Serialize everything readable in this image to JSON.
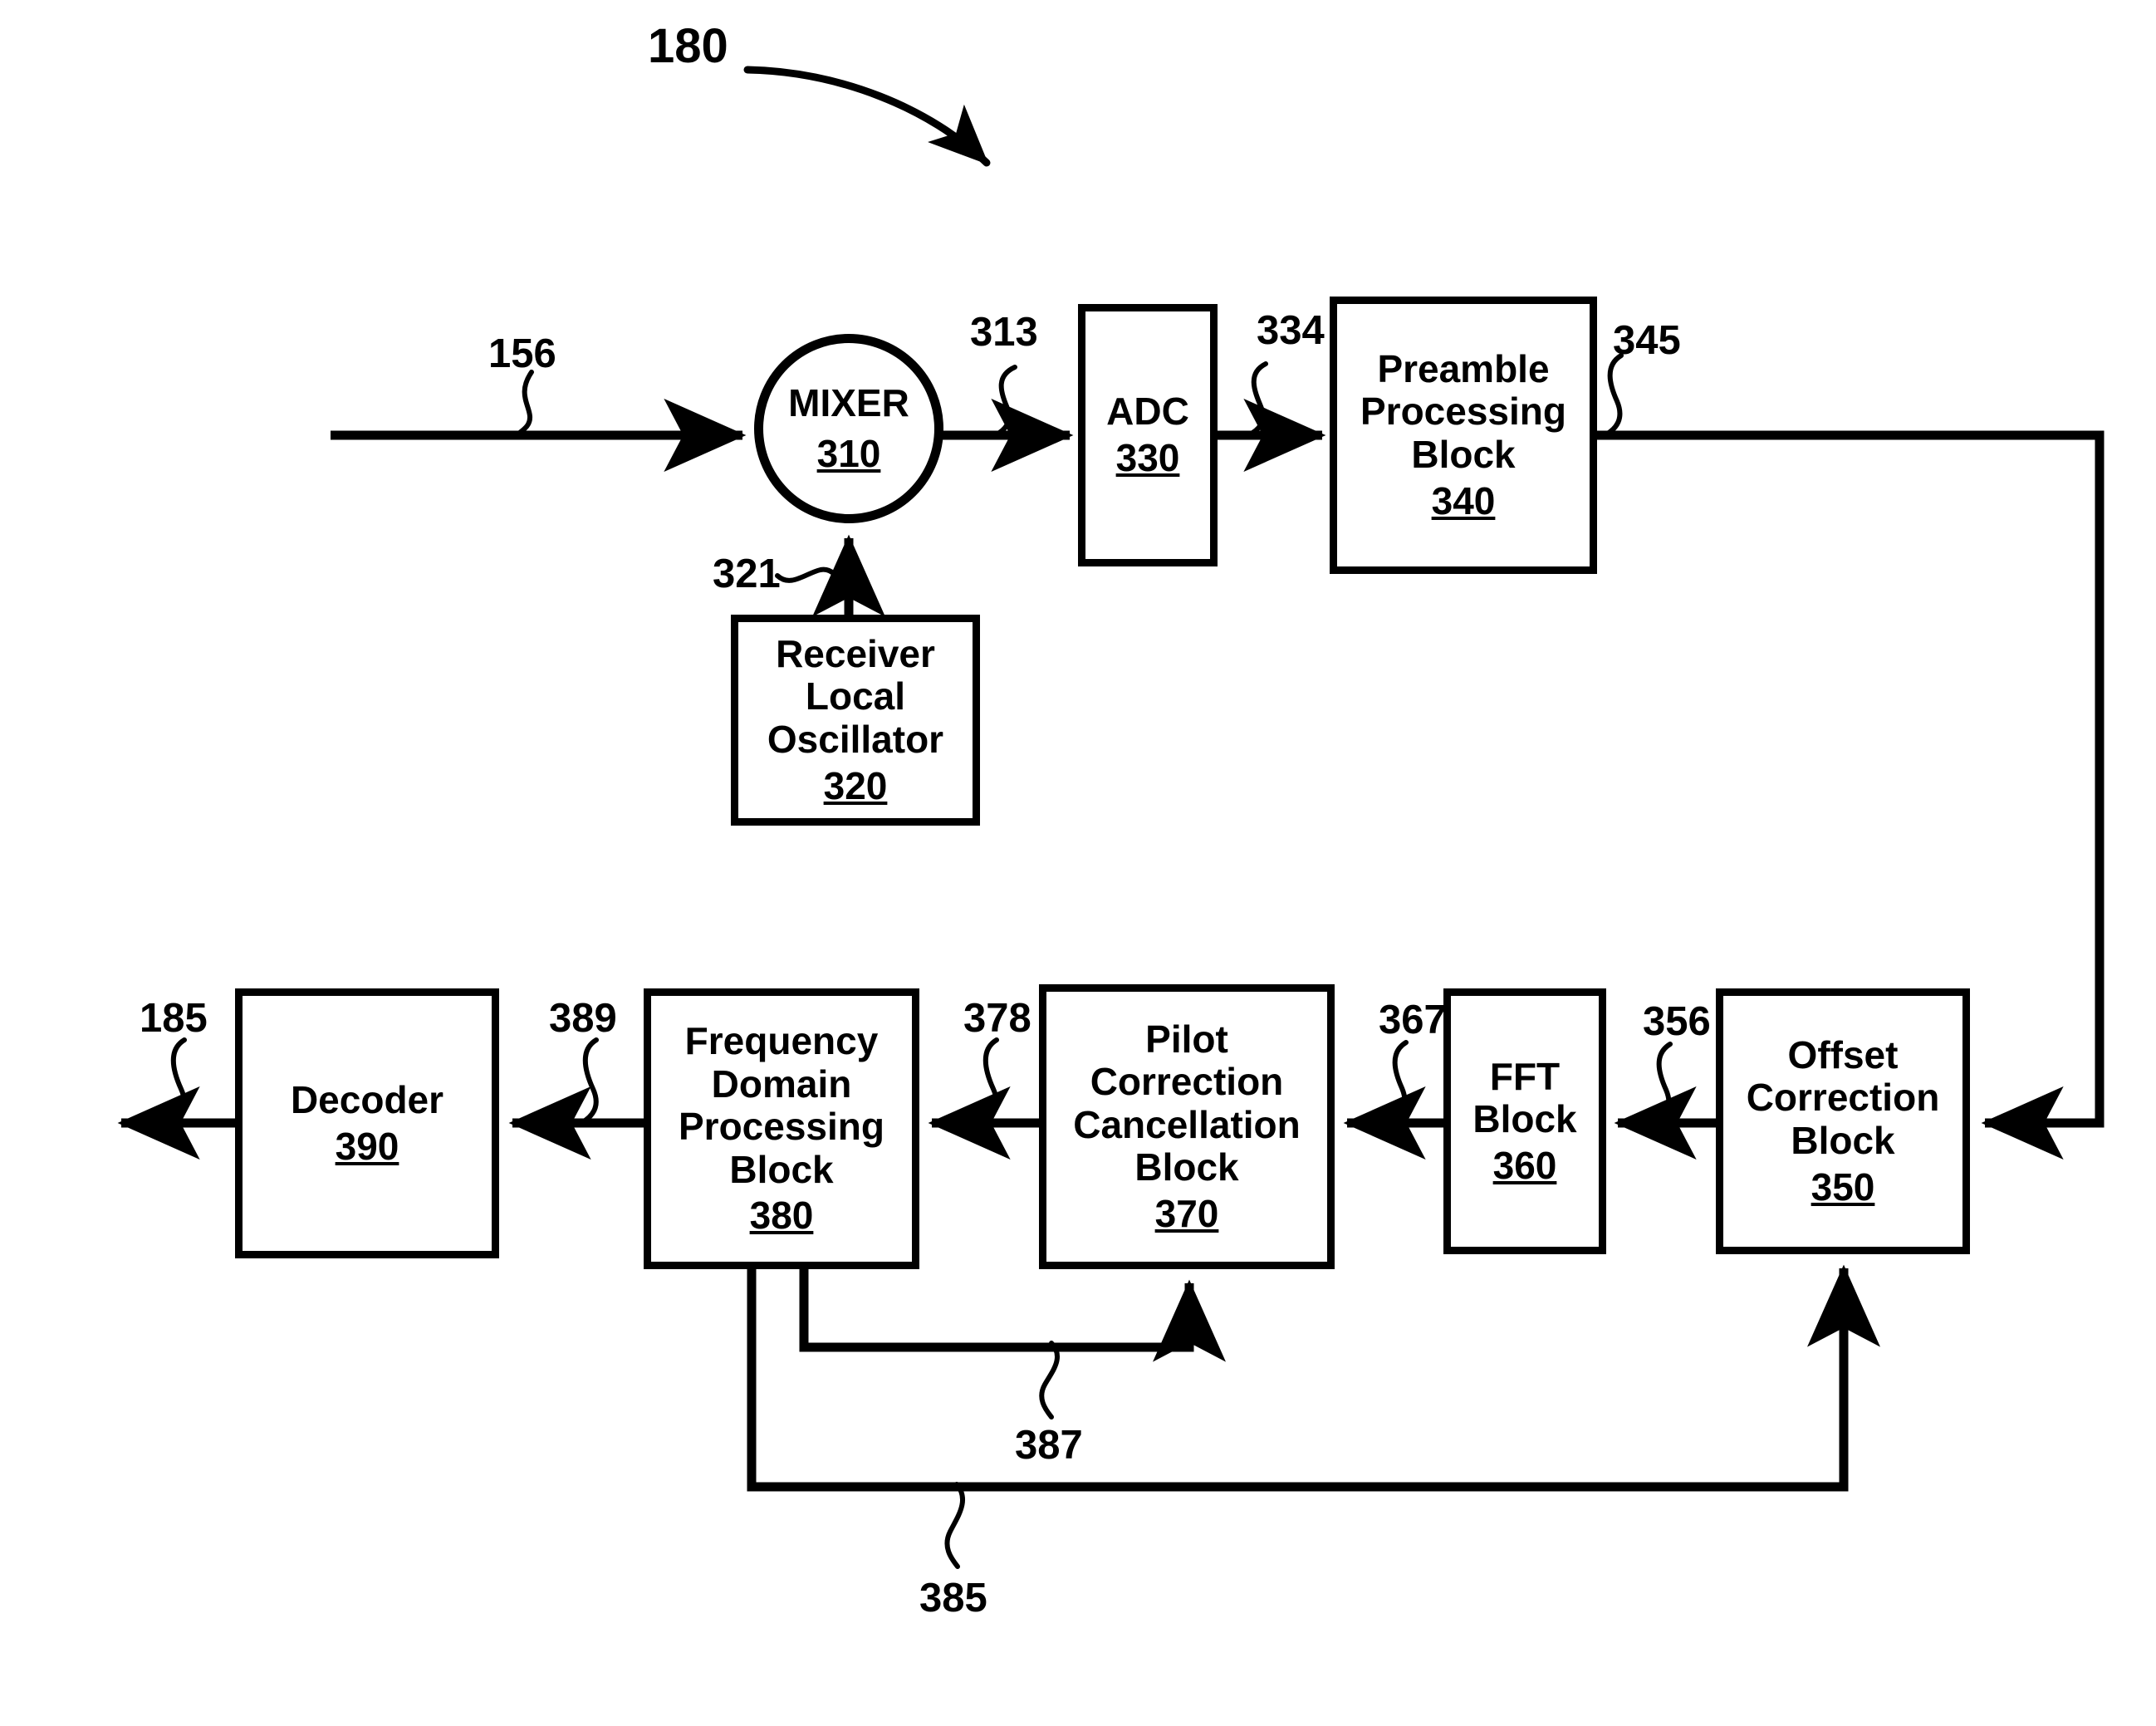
{
  "figure": {
    "figure_ref": "180",
    "blocks": [
      {
        "id": "mixer",
        "title": "MIXER",
        "ref": "310"
      },
      {
        "id": "adc",
        "title": "ADC",
        "ref": "330"
      },
      {
        "id": "preamble",
        "title": "Preamble\nProcessing\nBlock",
        "ref": "340"
      },
      {
        "id": "rlo",
        "title": "Receiver\nLocal\nOscillator",
        "ref": "320"
      },
      {
        "id": "offset",
        "title": "Offset\nCorrection\nBlock",
        "ref": "350"
      },
      {
        "id": "fft",
        "title": "FFT\nBlock",
        "ref": "360"
      },
      {
        "id": "pilot",
        "title": "Pilot\nCorrection\nCancellation\nBlock",
        "ref": "370"
      },
      {
        "id": "fdp",
        "title": "Frequency\nDomain\nProcessing\nBlock",
        "ref": "380"
      },
      {
        "id": "decoder",
        "title": "Decoder",
        "ref": "390"
      }
    ],
    "signal_labels": [
      {
        "id": "input-156",
        "text": "156"
      },
      {
        "id": "mixer-out-313",
        "text": "313"
      },
      {
        "id": "adc-out-334",
        "text": "334"
      },
      {
        "id": "preamble-out-345",
        "text": "345"
      },
      {
        "id": "lo-out-321",
        "text": "321"
      },
      {
        "id": "offset-out-356",
        "text": "356"
      },
      {
        "id": "fft-out-367",
        "text": "367"
      },
      {
        "id": "pilot-out-378",
        "text": "378"
      },
      {
        "id": "fdp-out-389",
        "text": "389"
      },
      {
        "id": "decoder-out-185",
        "text": "185"
      },
      {
        "id": "feedback-387",
        "text": "387"
      },
      {
        "id": "feedback-385",
        "text": "385"
      }
    ]
  }
}
